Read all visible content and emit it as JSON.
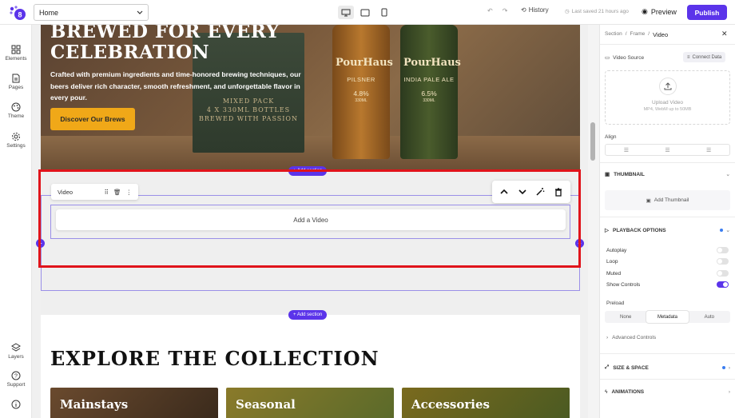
{
  "topbar": {
    "page_select": "Home",
    "history": "History",
    "last_saved": "Last saved 21 hours ago",
    "preview": "Preview",
    "publish": "Publish"
  },
  "rail": {
    "elements": "Elements",
    "pages": "Pages",
    "theme": "Theme",
    "settings": "Settings",
    "layers": "Layers",
    "support": "Support"
  },
  "hero": {
    "title": "BREWED FOR EVERY CELEBRATION",
    "subtitle": "Crafted with premium ingredients and time-honored brewing techniques, our beers deliver rich character, smooth refreshment, and unforgettable flavor in every pour.",
    "button": "Discover Our Brews",
    "box_label": "MIXED PACK\n4 X 330ML BOTTLES\nBREWED WITH PASSION",
    "bottle1": {
      "brand": "PourHaus",
      "style": "PILSNER",
      "abv": "4.8%",
      "vol": "330ML"
    },
    "bottle2": {
      "brand": "PourHaus",
      "style": "INDIA PALE ALE",
      "abv": "6.5%",
      "vol": "330ML"
    }
  },
  "canvas": {
    "add_section": "+ Add section",
    "video_label": "Video",
    "add_video": "Add a Video"
  },
  "explore": {
    "title": "EXPLORE THE COLLECTION",
    "cards": [
      "Mainstays",
      "Seasonal",
      "Accessories"
    ]
  },
  "panel": {
    "crumbs": [
      "Section",
      "Frame",
      "Video"
    ],
    "video_source": "Video Source",
    "connect_data": "Connect Data",
    "upload_title": "Upload Video",
    "upload_hint": "MP4, WebM up to 50MB",
    "align": "Align",
    "thumbnail": "THUMBNAIL",
    "add_thumbnail": "Add Thumbnail",
    "playback": "PLAYBACK OPTIONS",
    "autoplay": "Autoplay",
    "loop": "Loop",
    "muted": "Muted",
    "show_controls": "Show Controls",
    "preload": "Preload",
    "preload_opts": [
      "None",
      "Metadata",
      "Auto"
    ],
    "advanced": "Advanced Controls",
    "size_space": "SIZE & SPACE",
    "animations": "ANIMATIONS"
  },
  "toggles": {
    "autoplay": false,
    "loop": false,
    "muted": false,
    "show_controls": true
  },
  "colors": {
    "accent": "#5b34ea",
    "selection": "#e0141b",
    "hero_button": "#f0a818"
  }
}
